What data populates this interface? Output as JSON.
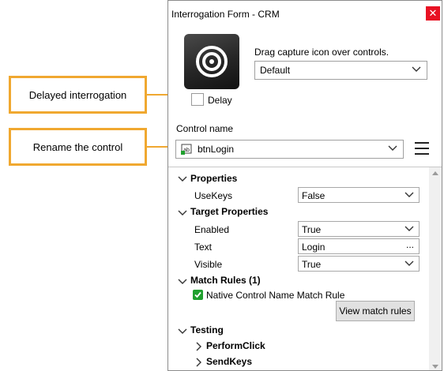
{
  "callouts": {
    "delayed": "Delayed interrogation",
    "rename": "Rename the control"
  },
  "window": {
    "title": "Interrogation Form - CRM",
    "close_glyph": "✕",
    "capture_hint": "Drag capture icon over controls.",
    "mode_value": "Default",
    "delay_label": "Delay",
    "control_name_label": "Control name",
    "control_name_value": "btnLogin"
  },
  "grid": {
    "properties": {
      "title": "Properties",
      "usekeys_label": "UseKeys",
      "usekeys_value": "False"
    },
    "target": {
      "title": "Target Properties",
      "enabled_label": "Enabled",
      "enabled_value": "True",
      "text_label": "Text",
      "text_value": "Login",
      "text_more": "...",
      "visible_label": "Visible",
      "visible_value": "True"
    },
    "match": {
      "title": "Match Rules (1)",
      "rule_label": "Native Control Name Match Rule",
      "view_button": "View match rules"
    },
    "testing": {
      "title": "Testing",
      "items": [
        "PerformClick",
        "SendKeys"
      ]
    }
  },
  "colors": {
    "callout_border": "#f0a830",
    "close_button": "#e81123",
    "check_green": "#1fa02e"
  },
  "icons": [
    "target-icon",
    "close-icon",
    "chevron-down-icon",
    "chevron-right-icon",
    "hamburger-menu-icon",
    "control-type-icon",
    "checkmark-icon"
  ]
}
